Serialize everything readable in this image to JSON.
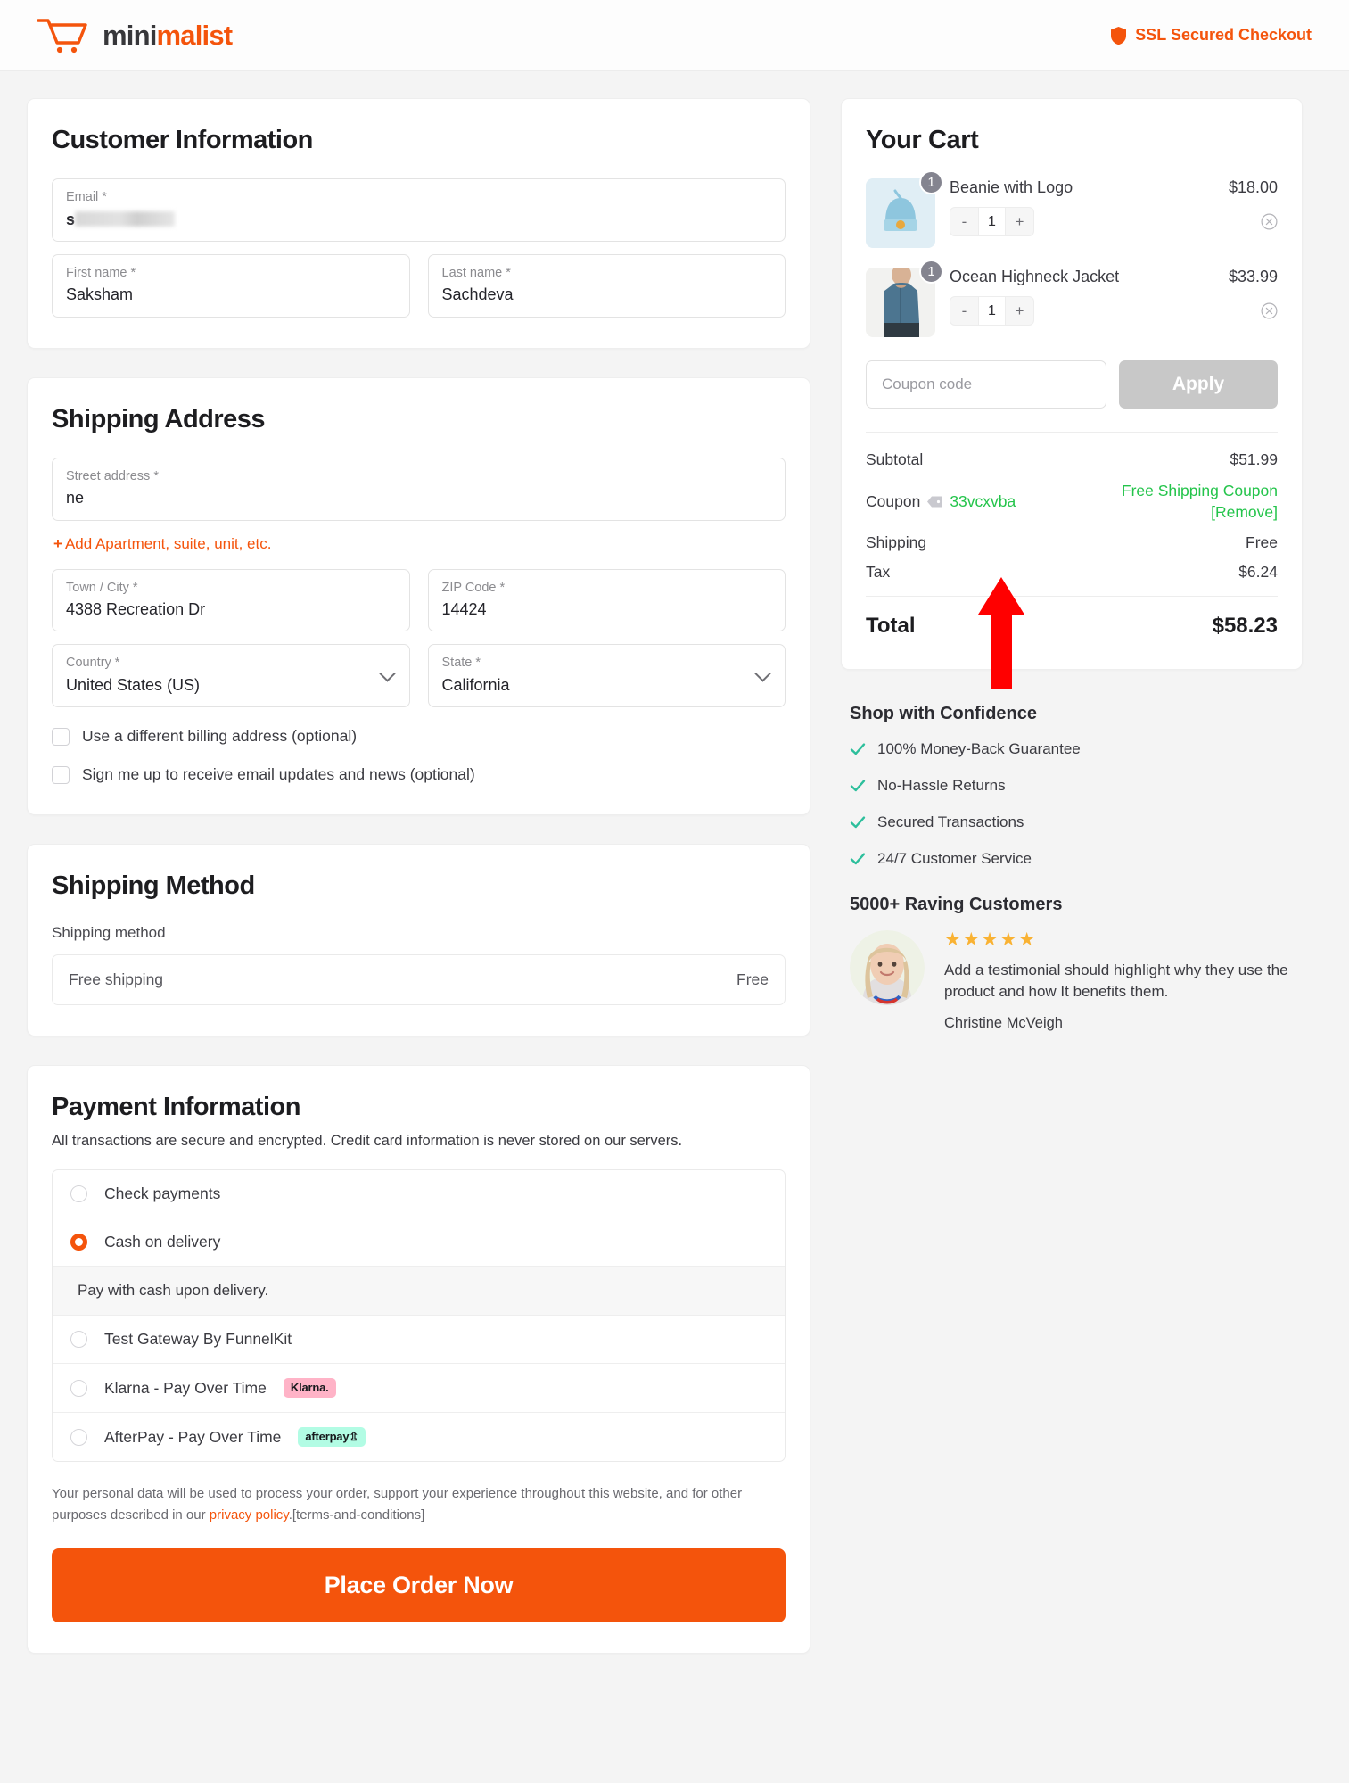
{
  "header": {
    "logo_text_dark": "mini",
    "logo_text_accent": "malist",
    "ssl_label": "SSL Secured Checkout",
    "accent_color": "#f4540c"
  },
  "customer": {
    "title": "Customer Information",
    "email": {
      "label": "Email *",
      "value": "s",
      "redacted": true
    },
    "first_name": {
      "label": "First name *",
      "value": "Saksham"
    },
    "last_name": {
      "label": "Last name *",
      "value": "Sachdeva"
    }
  },
  "shipping_address": {
    "title": "Shipping Address",
    "street": {
      "label": "Street address *",
      "value": "ne"
    },
    "add_apartment_link": "Add Apartment, suite, unit, etc.",
    "city": {
      "label": "Town / City *",
      "value": "4388 Recreation Dr"
    },
    "zip": {
      "label": "ZIP Code *",
      "value": "14424"
    },
    "country": {
      "label": "Country *",
      "value": "United States (US)"
    },
    "state": {
      "label": "State *",
      "value": "California"
    },
    "billing_checkbox": {
      "label": "Use a different billing address (optional)",
      "checked": false
    },
    "newsletter_checkbox": {
      "label": "Sign me up to receive email updates and news (optional)",
      "checked": false
    }
  },
  "shipping_method": {
    "title": "Shipping Method",
    "sublabel": "Shipping method",
    "option_name": "Free shipping",
    "option_price": "Free"
  },
  "payment": {
    "title": "Payment Information",
    "description": "All transactions are secure and encrypted. Credit card information is never stored on our servers.",
    "methods": [
      {
        "label": "Check payments",
        "selected": false,
        "badge": null
      },
      {
        "label": "Cash on delivery",
        "selected": true,
        "badge": null
      },
      {
        "label": "Test Gateway By FunnelKit",
        "selected": false,
        "badge": null
      },
      {
        "label": "Klarna - Pay Over Time",
        "selected": false,
        "badge": "Klarna.",
        "badge_style": "klarna"
      },
      {
        "label": "AfterPay - Pay Over Time",
        "selected": false,
        "badge": "afterpay",
        "badge_style": "afterpay"
      }
    ],
    "selected_note": "Pay with cash upon delivery.",
    "legal_text_1": "Your personal data will be used to process your order, support your experience throughout this website, and for other purposes described in our ",
    "legal_link": "privacy policy",
    "legal_text_2": ".[terms-and-conditions]",
    "place_order_label": "Place Order Now"
  },
  "cart": {
    "title": "Your Cart",
    "items": [
      {
        "name": "Beanie with Logo",
        "price": "$18.00",
        "qty": "1",
        "qty_badge": "1",
        "thumb": "beanie"
      },
      {
        "name": "Ocean Highneck Jacket",
        "price": "$33.99",
        "qty": "1",
        "qty_badge": "1",
        "thumb": "jacket"
      }
    ],
    "stepper_minus": "-",
    "stepper_plus": "+",
    "coupon_placeholder": "Coupon code",
    "coupon_value": "",
    "apply_label": "Apply",
    "totals": {
      "subtotal_label": "Subtotal",
      "subtotal_value": "$51.99",
      "coupon_label": "Coupon",
      "coupon_code": "33vcxvba",
      "coupon_value_line1": "Free Shipping Coupon",
      "coupon_value_line2": "[Remove]",
      "shipping_label": "Shipping",
      "shipping_value": "Free",
      "tax_label": "Tax",
      "tax_value": "$6.24",
      "total_label": "Total",
      "total_value": "$58.23"
    },
    "coupon_success_color": "#24c44b"
  },
  "trust": {
    "title": "Shop with Confidence",
    "items": [
      "100% Money-Back Guarantee",
      "No-Hassle Returns",
      "Secured Transactions",
      "24/7 Customer Service"
    ],
    "check_color": "#2dbf9c"
  },
  "testimonial": {
    "title": "5000+ Raving Customers",
    "stars": "★★★★★",
    "star_color": "#f9b233",
    "text": "Add a testimonial should highlight why they use the product and how It benefits them.",
    "name": "Christine McVeigh"
  },
  "annotation": {
    "type": "arrow",
    "color": "#ff0000",
    "points_at": "coupon_code"
  }
}
